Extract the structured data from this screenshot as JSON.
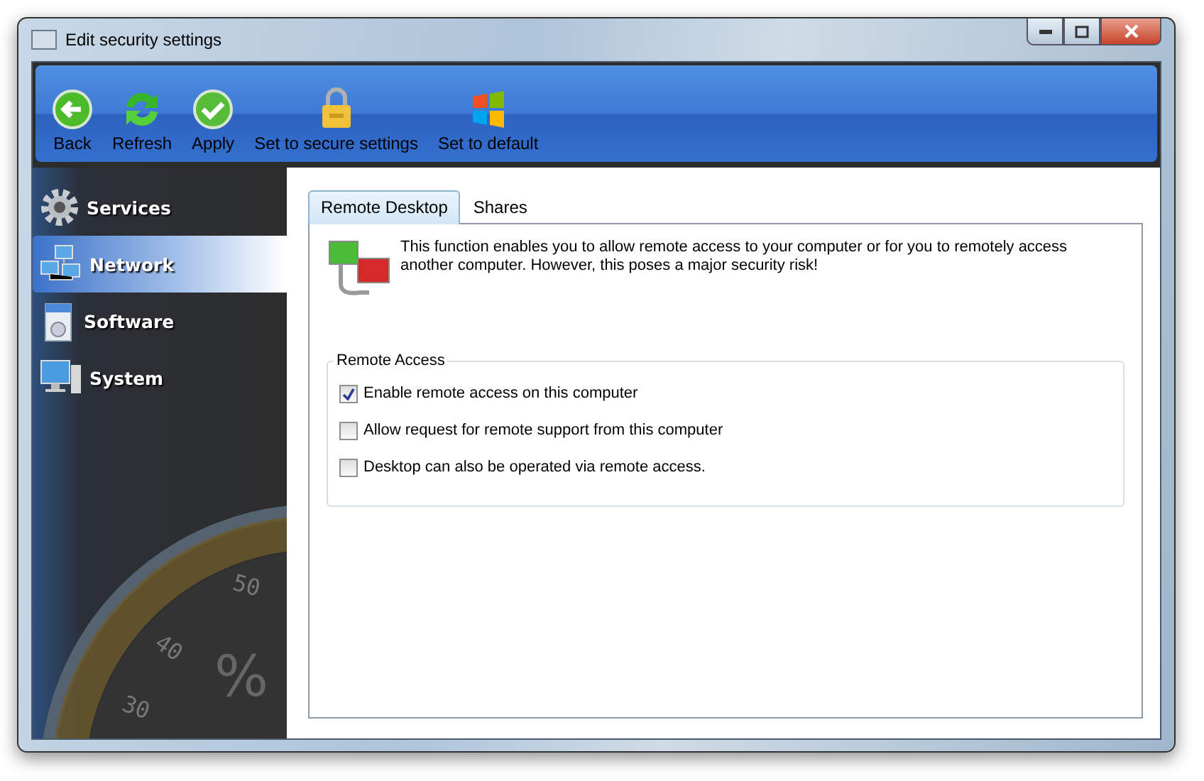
{
  "window": {
    "title": "Edit security settings"
  },
  "toolbar": [
    {
      "label": "Back",
      "kind": "back"
    },
    {
      "label": "Refresh",
      "kind": "refresh"
    },
    {
      "label": "Apply",
      "kind": "apply"
    },
    {
      "label": "Set to secure settings",
      "kind": "lock"
    },
    {
      "label": "Set to default",
      "kind": "flag"
    }
  ],
  "sidebar": {
    "items": [
      {
        "label": "Services",
        "kind": "gear",
        "selected": false
      },
      {
        "label": "Network",
        "kind": "network",
        "selected": true
      },
      {
        "label": "Software",
        "kind": "software",
        "selected": false
      },
      {
        "label": "System",
        "kind": "system",
        "selected": false
      }
    ],
    "gauge": {
      "labels": [
        "30",
        "40",
        "50"
      ],
      "unit": "%"
    }
  },
  "tabs": [
    {
      "label": "Remote Desktop",
      "selected": true
    },
    {
      "label": "Shares",
      "selected": false
    }
  ],
  "description": "This function enables you to allow remote access to your computer or for you to remotely access another computer. However, this poses a major security risk!",
  "group": {
    "title": "Remote Access",
    "options": [
      {
        "label": "Enable remote access on this computer",
        "checked": true
      },
      {
        "label": "Allow request for remote support from this computer",
        "checked": false
      },
      {
        "label": "Desktop can also be operated via remote access.",
        "checked": false
      }
    ]
  }
}
